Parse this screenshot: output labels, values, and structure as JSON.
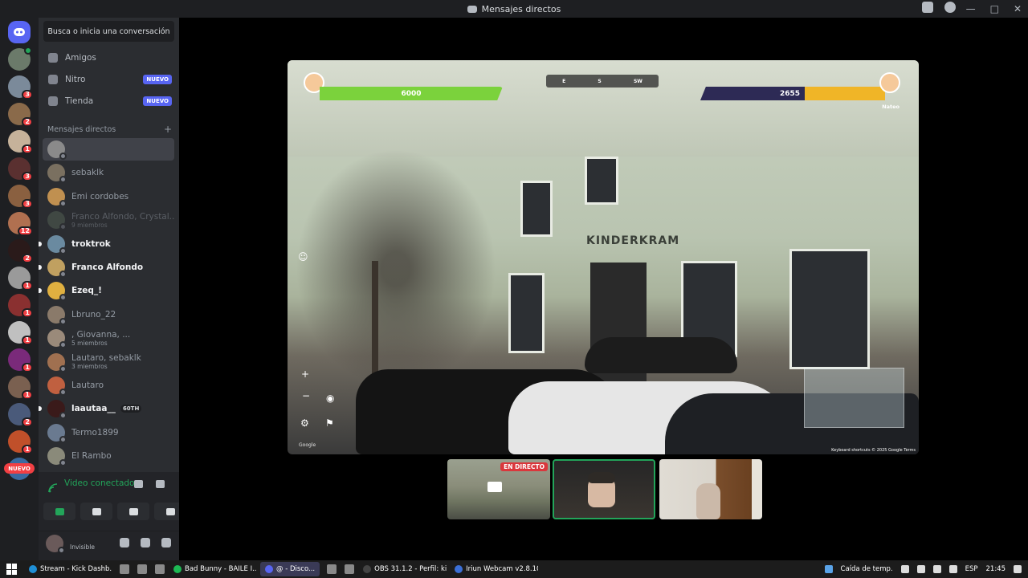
{
  "window": {
    "title": "Mensajes directos"
  },
  "sidebar": {
    "search_placeholder": "Busca o inicia una conversación",
    "nav": [
      {
        "label": "Amigos",
        "icon": "friends-icon"
      },
      {
        "label": "Nitro",
        "icon": "nitro-icon",
        "badge": "NUEVO"
      },
      {
        "label": "Tienda",
        "icon": "shop-icon",
        "badge": "NUEVO"
      }
    ],
    "dm_header": "Mensajes directos",
    "dm_add": "+",
    "dms": [
      {
        "name": "",
        "sub": "",
        "active": true
      },
      {
        "name": "sebaklk",
        "sub": ""
      },
      {
        "name": "Emi cordobes",
        "sub": ""
      },
      {
        "name": "Franco Alfondo, Crystal...",
        "sub": "9 miembros",
        "dim": true
      },
      {
        "name": "troktrok",
        "sub": "",
        "unread": true
      },
      {
        "name": "Franco Alfondo",
        "sub": "",
        "unread": true
      },
      {
        "name": "Ezeq_!",
        "sub": "",
        "unread": true
      },
      {
        "name": "Lbruno_22",
        "sub": ""
      },
      {
        "name": ", Giovanna, ...",
        "sub": "5 miembros"
      },
      {
        "name": "Lautaro, sebaklk",
        "sub": "3 miembros"
      },
      {
        "name": "Lautaro",
        "sub": ""
      },
      {
        "name": "laautaa__",
        "sub": "",
        "unread": true,
        "nitro": "60TH"
      },
      {
        "name": "Termo1899",
        "sub": ""
      },
      {
        "name": "El Rambo",
        "sub": ""
      }
    ]
  },
  "guilds": {
    "badges": [
      "",
      "3",
      "2",
      "1",
      "3",
      "3",
      "12",
      "2",
      "1",
      "1",
      "1",
      "1",
      "1",
      "2",
      "1",
      ""
    ],
    "nuevo": "NUEVO"
  },
  "voice": {
    "status": "Video conectado"
  },
  "user": {
    "status": "Invisible"
  },
  "stream": {
    "health_left": "6000",
    "score_right": "2655",
    "compass": [
      "E",
      "S",
      "SW"
    ],
    "player_name": "Nateo",
    "sign": "KINDERKRAM",
    "google": "Google",
    "terms": "Keyboard shortcuts   © 2025 Google   Terms"
  },
  "thumbnails": {
    "live_label": "EN DIRECTO"
  },
  "taskbar": {
    "tasks": [
      {
        "label": "Stream - Kick Dashb...",
        "color": "#1f8fd6"
      },
      {
        "label": "Bad Bunny - BAILE I...",
        "color": "#1db954"
      },
      {
        "label": "@            - Disco...",
        "color": "#5865f2",
        "active": true
      },
      {
        "label": "OBS 31.1.2 - Perfil: ki...",
        "color": "#444444"
      },
      {
        "label": "Iriun Webcam v2.8.10",
        "color": "#3b6fd6"
      }
    ],
    "weather": "Caída de temp.",
    "lang": "ESP",
    "time": "21:45"
  }
}
